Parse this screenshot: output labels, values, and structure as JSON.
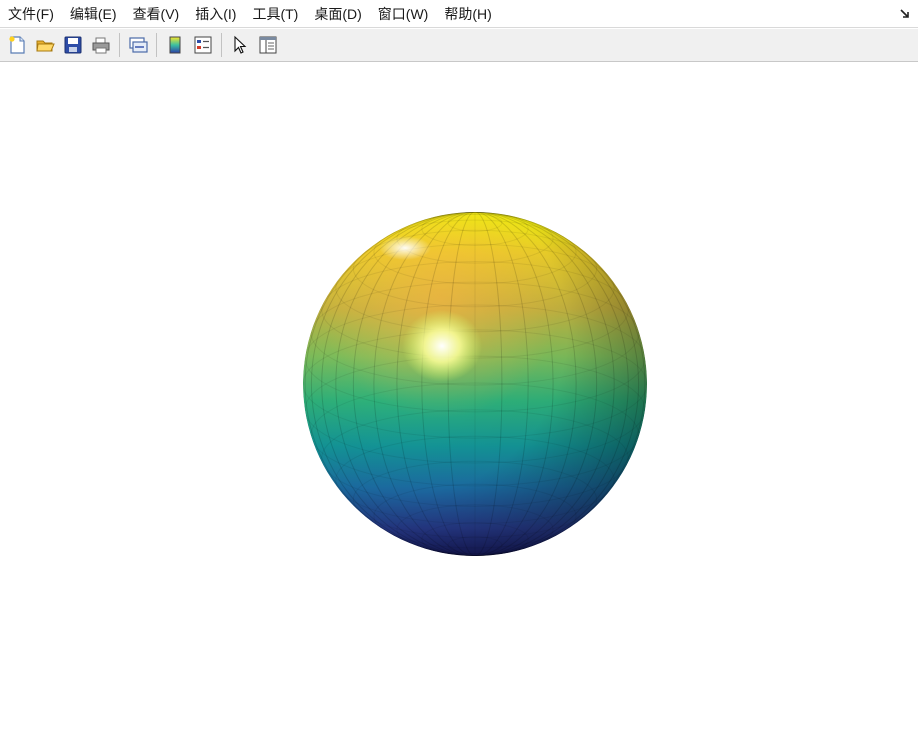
{
  "menubar": {
    "items": [
      "文件(F)",
      "编辑(E)",
      "查看(V)",
      "插入(I)",
      "工具(T)",
      "桌面(D)",
      "窗口(W)",
      "帮助(H)"
    ]
  },
  "toolbar": {
    "buttons": [
      {
        "icon": "new-figure-icon"
      },
      {
        "icon": "open-file-icon"
      },
      {
        "icon": "save-icon"
      },
      {
        "icon": "print-icon"
      },
      {
        "icon": "link-plot-icon"
      },
      {
        "icon": "insert-colorbar-icon"
      },
      {
        "icon": "insert-legend-icon"
      },
      {
        "icon": "edit-plot-pointer-icon"
      },
      {
        "icon": "property-inspector-icon"
      }
    ]
  },
  "figure": {
    "object": "sphere",
    "colormap": "parula",
    "shading": "faceted-lit",
    "colors": {
      "top": "#f9fb0e",
      "upper": "#f5b940",
      "middle": "#2fb47c",
      "lower": "#0f7ba0",
      "bottom": "#1a1e6a",
      "highlight": "#ffffff"
    }
  }
}
